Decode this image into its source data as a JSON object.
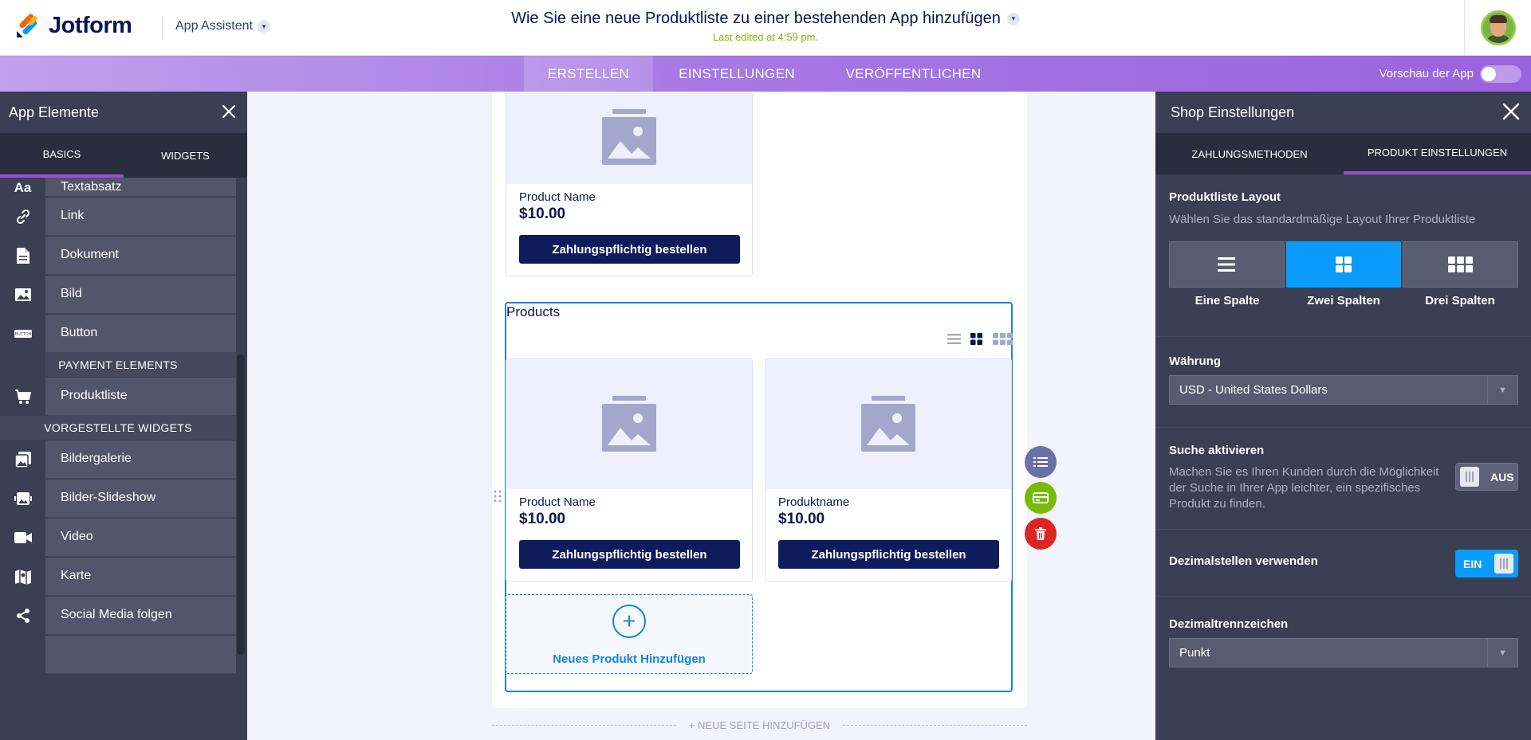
{
  "header": {
    "brand": "Jotform",
    "app_assistant": "App Assistent",
    "title": "Wie Sie eine neue Produktliste zu einer bestehenden App hinzufügen",
    "last_edited": "Last edited at 4:59 pm."
  },
  "nav": {
    "tabs": [
      {
        "label": "ERSTELLEN",
        "active": true
      },
      {
        "label": "EINSTELLUNGEN",
        "active": false
      },
      {
        "label": "VERÖFFENTLICHEN",
        "active": false
      }
    ],
    "preview_label": "Vorschau der App",
    "preview_on": false
  },
  "left_panel": {
    "title": "App Elemente",
    "tabs": [
      {
        "label": "BASICS",
        "active": true
      },
      {
        "label": "WIDGETS",
        "active": false
      }
    ],
    "items": [
      {
        "label": "Textabsatz",
        "icon": "text-icon"
      },
      {
        "label": "Link",
        "icon": "link-icon"
      },
      {
        "label": "Dokument",
        "icon": "document-icon"
      },
      {
        "label": "Bild",
        "icon": "image-icon"
      },
      {
        "label": "Button",
        "icon": "button-icon"
      }
    ],
    "payment_section": "PAYMENT ELEMENTS",
    "payment_items": [
      {
        "label": "Produktliste",
        "icon": "cart-icon"
      }
    ],
    "widgets_section": "VORGESTELLTE WIDGETS",
    "widget_items": [
      {
        "label": "Bildergalerie",
        "icon": "gallery-icon"
      },
      {
        "label": "Bilder-Slideshow",
        "icon": "slideshow-icon"
      },
      {
        "label": "Video",
        "icon": "video-icon"
      },
      {
        "label": "Karte",
        "icon": "map-icon"
      },
      {
        "label": "Social Media folgen",
        "icon": "share-icon"
      }
    ]
  },
  "canvas": {
    "top_product": {
      "name": "Product Name",
      "price": "$10.00",
      "button": "Zahlungspflichtig bestellen"
    },
    "products_title": "Products",
    "products": [
      {
        "name": "Product Name",
        "price": "$10.00",
        "button": "Zahlungspflichtig bestellen"
      },
      {
        "name": "Produktname",
        "price": "$10.00",
        "button": "Zahlungspflichtig bestellen"
      }
    ],
    "add_product": "Neues Produkt Hinzufügen",
    "add_page": "+ NEUE SEITE HINZUFÜGEN"
  },
  "right_panel": {
    "title": "Shop Einstellungen",
    "tabs": [
      {
        "label": "ZAHLUNGSMETHODEN",
        "active": false
      },
      {
        "label": "PRODUKT EINSTELLUNGEN",
        "active": true
      }
    ],
    "layout_label": "Produktliste Layout",
    "layout_desc": "Wählen Sie das standardmäßige Layout Ihrer Produktliste",
    "layout_options": [
      {
        "label": "Eine Spalte",
        "active": false
      },
      {
        "label": "Zwei Spalten",
        "active": true
      },
      {
        "label": "Drei Spalten",
        "active": false
      }
    ],
    "currency_label": "Währung",
    "currency_value": "USD - United States Dollars",
    "search_label": "Suche aktivieren",
    "search_desc": "Machen Sie es Ihren Kunden durch die Möglichkeit der Suche in Ihrer App leichter, ein spezifisches Produkt zu finden.",
    "search_toggle": "AUS",
    "decimals_label": "Dezimalstellen verwenden",
    "decimals_toggle": "EIN",
    "separator_label": "Dezimaltrennzeichen",
    "separator_value": "Punkt"
  },
  "colors": {
    "accent_blue": "#0a9cfc",
    "navy": "#0e1c5b",
    "purple": "#9c4dd3",
    "last_edited_green": "#78bb07"
  }
}
